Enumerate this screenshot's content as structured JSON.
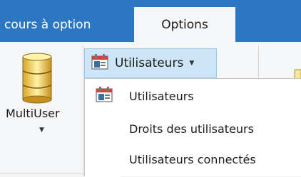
{
  "tabs": {
    "inactive_label": "cours à option",
    "active_label": "Options"
  },
  "ribbon": {
    "multiuser_label": "MultiUser",
    "multiuser_arrow": "▼",
    "users_button_label": "Utilisateurs",
    "users_button_arrow": "▼"
  },
  "menu": {
    "items": [
      {
        "label": "Utilisateurs",
        "icon": "users-calendar-icon"
      },
      {
        "label": "Droits des utilisateurs"
      },
      {
        "label": "Utilisateurs connectés"
      }
    ]
  },
  "colors": {
    "tab_bar": "#2b77c4",
    "ribbon_bg": "#f5f6f7",
    "button_hover": "#cde6f7",
    "button_border": "#9cc9ea"
  }
}
